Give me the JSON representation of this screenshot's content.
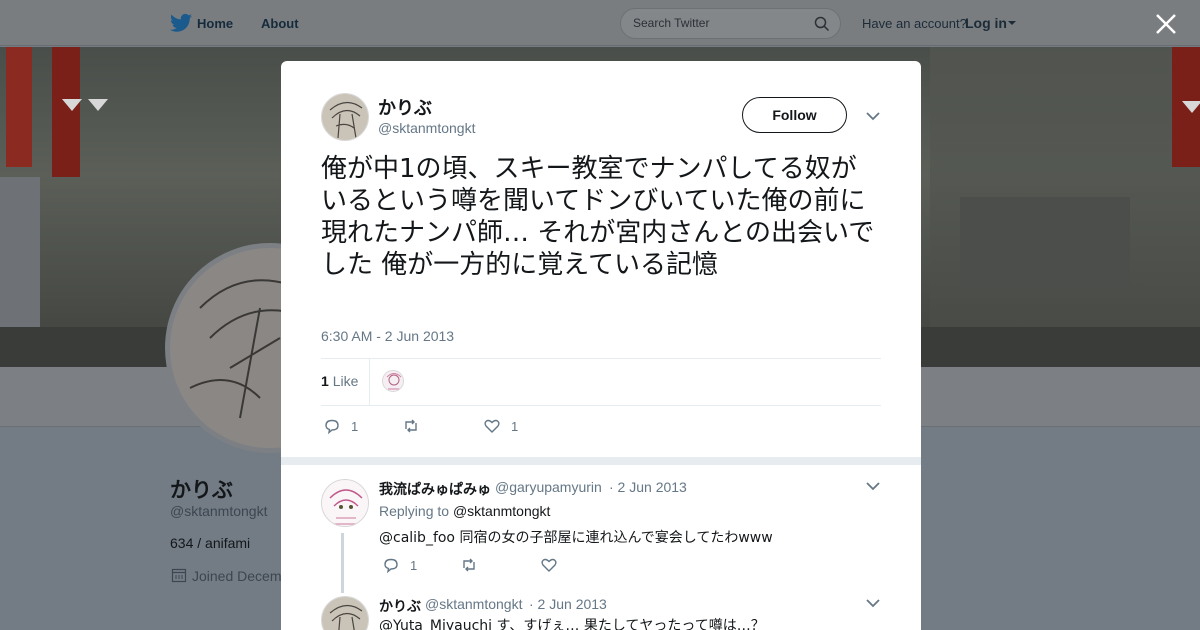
{
  "topbar": {
    "home_label": "Home",
    "about_label": "About",
    "search_placeholder": "Search Twitter",
    "have_account": "Have an account?",
    "login_label": "Log in"
  },
  "profile": {
    "name": "かりぶ",
    "handle": "@sktanmtongkt",
    "bio": "634 / anifami",
    "joined": "Joined Decem"
  },
  "tweet": {
    "author_name": "かりぶ",
    "author_handle": "@sktanmtongkt",
    "follow_label": "Follow",
    "text": "俺が中1の頃、スキー教室でナンパしてる奴がいるという噂を聞いてドンびいていた俺の前に現れたナンパ師… それが宮内さんとの出会いでした 俺が一方的に覚えている記憶",
    "timestamp": "6:30 AM - 2 Jun 2013",
    "likes_count": "1",
    "likes_label": "Like",
    "actions": {
      "reply_count": "1",
      "retweet_count": "",
      "like_count": "1"
    }
  },
  "replies": [
    {
      "name": "我流ぱみゅぱみゅ",
      "handle": "@garyupamyurin",
      "date": "· 2 Jun 2013",
      "replying_prefix": "Replying to",
      "replying_handle": "@sktanmtongkt",
      "text": "@calib_foo 同宿の女の子部屋に連れ込んで宴会してたわwww",
      "reply_count": "1"
    },
    {
      "name": "かりぶ",
      "handle": "@sktanmtongkt",
      "date": "· 2 Jun 2013",
      "text": "@Yuta_Miyauchi す、すげぇ… 果たしてヤったって噂は…？"
    }
  ],
  "colors": {
    "overlay": "#737c85",
    "modal_bg": "#ffffff",
    "text_primary": "#14171a",
    "text_secondary": "#657786",
    "divider": "#e6ecf0"
  },
  "icons": [
    "twitter-bird-icon",
    "search-icon",
    "close-icon",
    "chevron-down-icon",
    "reply-icon",
    "retweet-icon",
    "heart-icon",
    "calendar-icon"
  ]
}
